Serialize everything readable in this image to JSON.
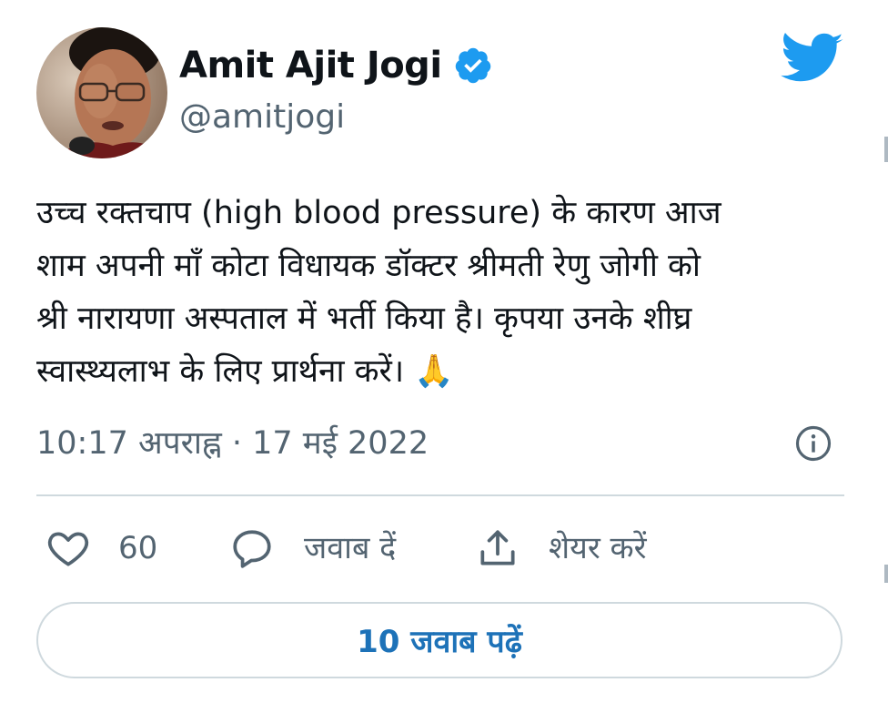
{
  "author": {
    "name": "Amit Ajit Jogi",
    "handle": "@amitjogi",
    "verified": true
  },
  "icons": {
    "avatar": "profile-photo",
    "verified": "verified-badge-icon",
    "brand": "twitter-bird-icon",
    "info": "info-icon",
    "like": "heart-icon",
    "reply": "speech-bubble-icon",
    "share": "share-upload-icon"
  },
  "tweet": {
    "text": "उच्च रक्तचाप (high blood pressure) के कारण आज\nशाम अपनी माँ कोटा विधायक डॉक्टर श्रीमती रेणु जोगी को\nश्री नारायणा अस्पताल में भर्ती किया है। कृपया उनके शीघ्र\nस्वास्थ्यलाभ के लिए प्रार्थना करें। 🙏",
    "timestamp": "10:17 अपराह्न · 17 मई 2022"
  },
  "actions": {
    "like_count": "60",
    "reply_label": "जवाब दें",
    "share_label": "शेयर करें"
  },
  "footer": {
    "read_replies_label": "10 जवाब पढ़ें"
  },
  "colors": {
    "brand_blue": "#1d9bf0",
    "link_blue": "#1d72b8",
    "secondary_text": "#536471",
    "divider": "#cfd9de"
  }
}
